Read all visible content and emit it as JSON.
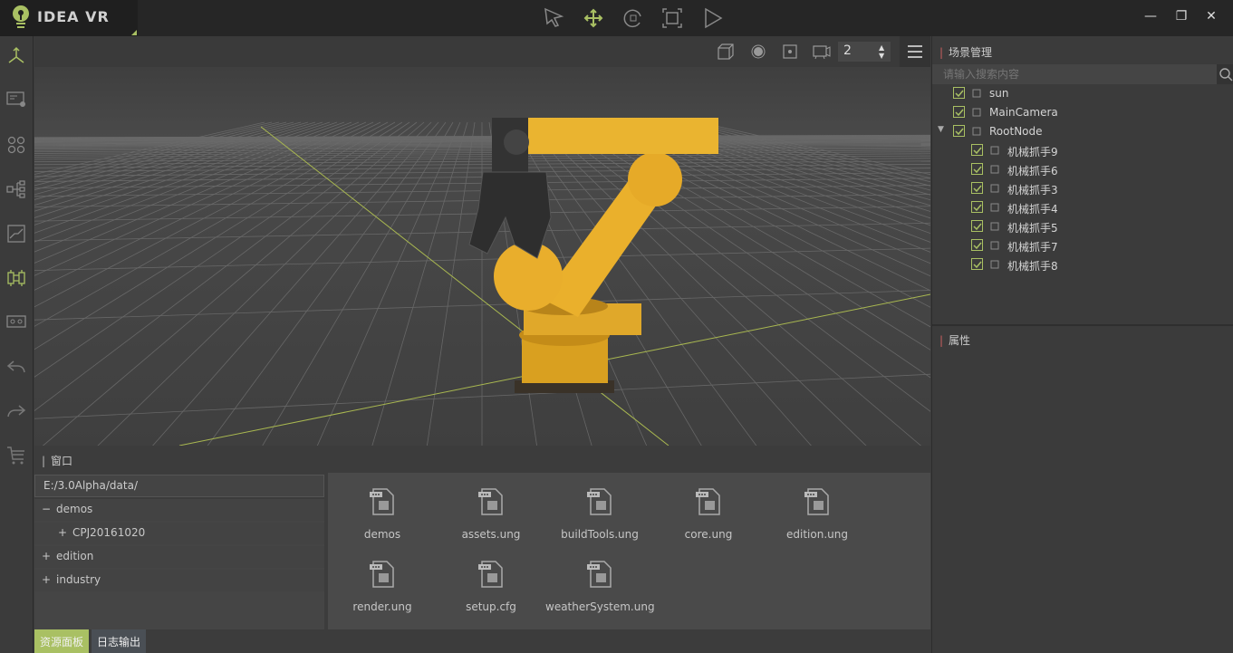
{
  "app": {
    "title": "IDEA VR",
    "accent": "#a9c063"
  },
  "toolbar": {
    "tools": [
      "select-icon",
      "move-icon",
      "rotate-icon",
      "scale-icon",
      "play-icon"
    ],
    "active": "move-icon"
  },
  "window_controls": {
    "minimize": "—",
    "maximize": "❐",
    "close": "✕"
  },
  "sidebar": {
    "items": [
      "axis-icon",
      "edit-screen-icon",
      "grid-icon",
      "hierarchy-icon",
      "chart-icon",
      "component-icon",
      "vr-glasses-icon",
      "undo-icon",
      "redo-icon",
      "cart-icon"
    ],
    "active": "component-icon"
  },
  "viewport": {
    "camera_index": "2"
  },
  "scene": {
    "title": "场景管理",
    "search_placeholder": "请输入搜索内容",
    "nodes": [
      {
        "label": "sun",
        "checked": true,
        "icon": "light-icon"
      },
      {
        "label": "MainCamera",
        "checked": true,
        "icon": "camera-icon"
      },
      {
        "label": "RootNode",
        "checked": true,
        "icon": "gear-icon",
        "expanded": true
      },
      {
        "label": "机械抓手9",
        "checked": true
      },
      {
        "label": "机械抓手6",
        "checked": true
      },
      {
        "label": "机械抓手3",
        "checked": true
      },
      {
        "label": "机械抓手4",
        "checked": true
      },
      {
        "label": "机械抓手5",
        "checked": true
      },
      {
        "label": "机械抓手7",
        "checked": true
      },
      {
        "label": "机械抓手8",
        "checked": true
      }
    ]
  },
  "properties": {
    "title": "属性"
  },
  "bottom": {
    "title": "窗口",
    "path": "E:/3.0Alpha/data/",
    "folders": [
      {
        "sign": "−",
        "label": "demos"
      },
      {
        "sign": "+",
        "label": "CPJ20161020"
      },
      {
        "sign": "+",
        "label": "edition"
      },
      {
        "sign": "+",
        "label": "industry"
      }
    ],
    "files": [
      "demos",
      "assets.ung",
      "buildTools.ung",
      "core.ung",
      "edition.ung",
      "render.ung",
      "setup.cfg",
      "weatherSystem.ung"
    ],
    "tabs": [
      "资源面板",
      "日志输出"
    ],
    "active_tab": "资源面板"
  }
}
